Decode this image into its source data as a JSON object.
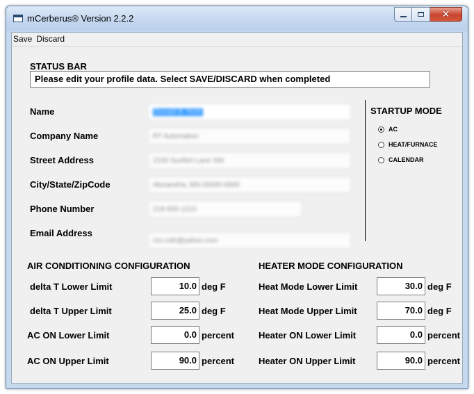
{
  "window": {
    "title": "mCerberus® Version 2.2.2"
  },
  "menu": {
    "save": "Save",
    "discard": "Discard"
  },
  "status": {
    "title": "STATUS BAR",
    "message": "Please edit your profile data. Select SAVE/DISCARD when completed"
  },
  "profile": {
    "name": {
      "label": "Name",
      "value": "Donald B. Roth"
    },
    "company": {
      "label": "Company Name",
      "value": "RT Automation"
    },
    "street": {
      "label": "Street Address",
      "value": "2100 Sunfish Lane SW"
    },
    "city": {
      "label": "City/State/ZipCode",
      "value": "Alexandria, MN 00000-0000"
    },
    "phone": {
      "label": "Phone Number",
      "value": "218-555-1210"
    },
    "email": {
      "label": "Email Address",
      "value": "ron.roth@yahoo.com"
    }
  },
  "startup": {
    "title": "STARTUP MODE",
    "options": [
      {
        "label": "AC",
        "selected": true
      },
      {
        "label": "HEAT/FURNACE",
        "selected": false
      },
      {
        "label": "CALENDAR",
        "selected": false
      }
    ]
  },
  "ac": {
    "title": "AIR CONDITIONING CONFIGURATION",
    "rows": [
      {
        "label": "delta T Lower Limit",
        "value": "10.0",
        "unit": "deg F"
      },
      {
        "label": "delta T Upper Limit",
        "value": "25.0",
        "unit": "deg F"
      },
      {
        "label": "AC ON Lower Limit",
        "value": "0.0",
        "unit": "percent"
      },
      {
        "label": "AC ON Upper Limit",
        "value": "90.0",
        "unit": "percent"
      }
    ]
  },
  "heater": {
    "title": "HEATER MODE CONFIGURATION",
    "rows": [
      {
        "label": "Heat Mode Lower Limit",
        "value": "30.0",
        "unit": "deg F"
      },
      {
        "label": "Heat Mode Upper Limit",
        "value": "70.0",
        "unit": "deg F"
      },
      {
        "label": "Heater ON Lower Limit",
        "value": "0.0",
        "unit": "percent"
      },
      {
        "label": "Heater ON Upper Limit",
        "value": "90.0",
        "unit": "percent"
      }
    ]
  }
}
